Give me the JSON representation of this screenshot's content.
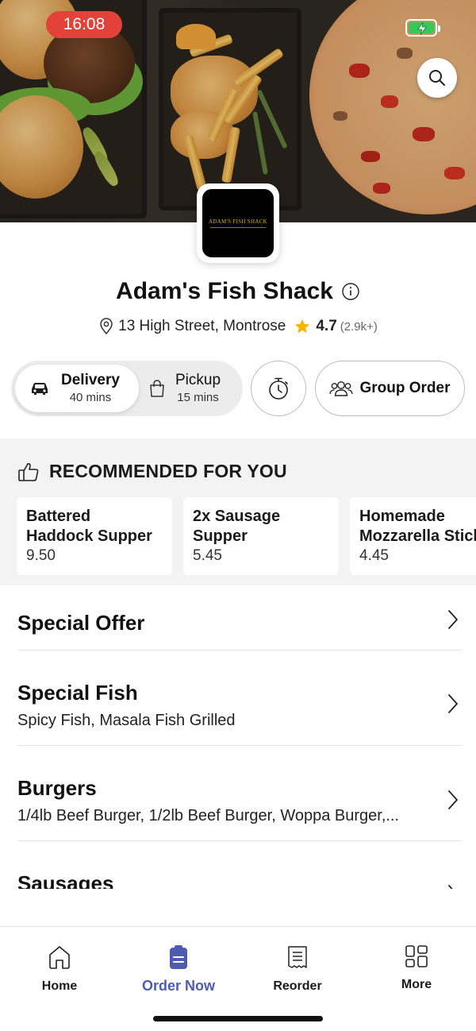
{
  "status_bar": {
    "time": "16:08"
  },
  "restaurant": {
    "logo_text": "ADAM'S FISH SHACK",
    "name": "Adam's Fish Shack",
    "address": "13 High Street, Montrose",
    "rating": "4.7",
    "rating_count": "(2.9k+)"
  },
  "order_mode": {
    "delivery_label": "Delivery",
    "delivery_time": "40 mins",
    "pickup_label": "Pickup",
    "pickup_time": "15 mins",
    "selected": "Delivery",
    "group_order_label": "Group Order"
  },
  "recommended": {
    "title": "RECOMMENDED FOR YOU",
    "items": [
      {
        "name_line1": "Battered",
        "name_line2": "Haddock Supper",
        "price": "9.50"
      },
      {
        "name_line1": "2x Sausage",
        "name_line2": "Supper",
        "price": "5.45"
      },
      {
        "name_line1": "Homemade",
        "name_line2": "Mozzarella Stick",
        "price": "4.45"
      }
    ]
  },
  "menu": {
    "categories": [
      {
        "name": "Special Offer",
        "description": ""
      },
      {
        "name": "Special Fish",
        "description": "Spicy Fish, Masala Fish Grilled"
      },
      {
        "name": "Burgers",
        "description": "1/4lb Beef Burger, 1/2lb Beef Burger, Woppa Burger,..."
      },
      {
        "name": "Sausages",
        "description": ""
      }
    ]
  },
  "bottom_nav": {
    "items": [
      {
        "label": "Home",
        "icon": "home-icon"
      },
      {
        "label": "Order Now",
        "icon": "order-now-icon"
      },
      {
        "label": "Reorder",
        "icon": "receipt-icon"
      },
      {
        "label": "More",
        "icon": "grid-icon"
      }
    ],
    "active": "Order Now"
  },
  "colors": {
    "accent": "#4f5bb3",
    "time_pill": "#e3413a",
    "star": "#f5b400",
    "battery": "#37c85a"
  }
}
